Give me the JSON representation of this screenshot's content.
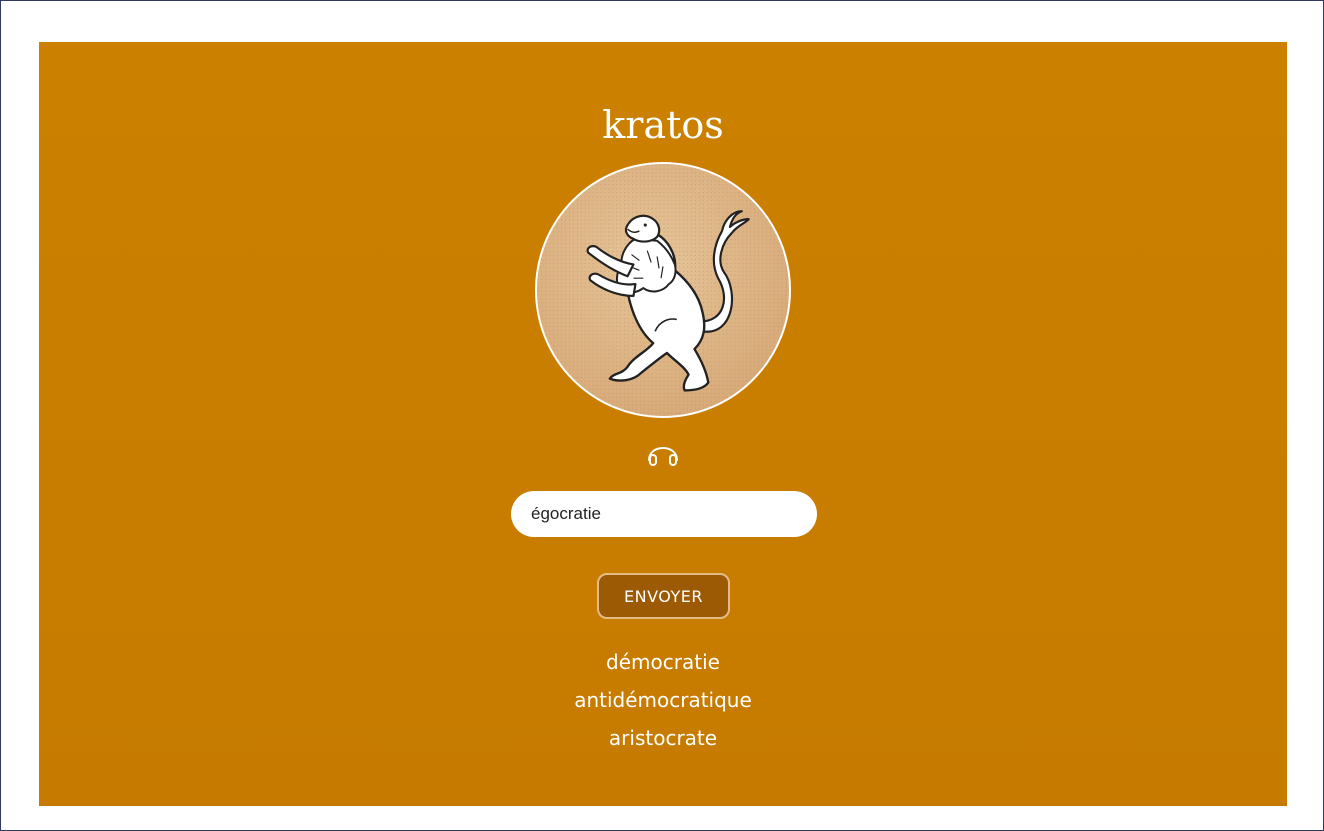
{
  "app": {
    "title": "kratos"
  },
  "illustration": {
    "icon": "rampant-lion-icon"
  },
  "audio": {
    "icon": "headphones-icon"
  },
  "form": {
    "input_value": "égocratie",
    "submit_label": "ENVOYER"
  },
  "results": [
    "démocratie",
    "antidémocratique",
    "aristocrate"
  ],
  "colors": {
    "panel_background": "#c97e00",
    "button_background": "#9c5a05",
    "button_border": "#e3bb86",
    "text": "#ffffff",
    "frame_border": "#2f3a63"
  }
}
